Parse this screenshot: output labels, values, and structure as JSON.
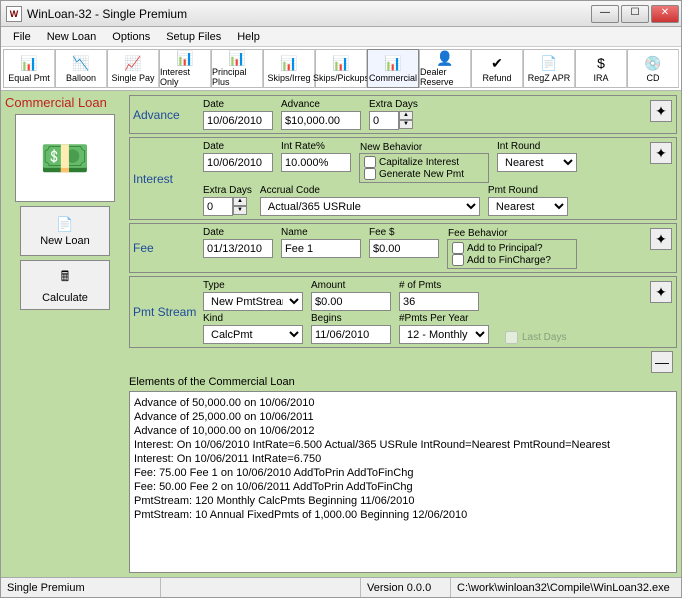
{
  "window": {
    "title": "WinLoan-32 - Single Premium",
    "icon": "W"
  },
  "menu": [
    "File",
    "New Loan",
    "Options",
    "Setup Files",
    "Help"
  ],
  "toolbar": [
    {
      "label": "Equal Pmt",
      "icon": "📊",
      "active": false
    },
    {
      "label": "Balloon",
      "icon": "📉",
      "active": false
    },
    {
      "label": "Single Pay",
      "icon": "📈",
      "active": false
    },
    {
      "label": "Interest Only",
      "icon": "📊",
      "active": false
    },
    {
      "label": "Principal Plus",
      "icon": "📊",
      "active": false
    },
    {
      "label": "Skips/Irreg",
      "icon": "📊",
      "active": false
    },
    {
      "label": "Skips/Pickups",
      "icon": "📊",
      "active": false
    },
    {
      "label": "Commercial",
      "icon": "📊",
      "active": true
    },
    {
      "label": "Dealer Reserve",
      "icon": "👤",
      "active": false
    },
    {
      "label": "Refund",
      "icon": "✔",
      "active": false
    },
    {
      "label": "RegZ APR",
      "icon": "📄",
      "active": false
    },
    {
      "label": "IRA",
      "icon": "$",
      "active": false
    },
    {
      "label": "CD",
      "icon": "💿",
      "active": false
    }
  ],
  "loan_title": "Commercial Loan",
  "left_buttons": {
    "new_loan": "New Loan",
    "calculate": "Calculate"
  },
  "advance": {
    "title": "Advance",
    "date_label": "Date",
    "date": "10/06/2010",
    "advance_label": "Advance",
    "advance": "$10,000.00",
    "extra_days_label": "Extra Days",
    "extra_days": "0"
  },
  "interest": {
    "title": "Interest",
    "date_label": "Date",
    "date": "10/06/2010",
    "rate_label": "Int Rate%",
    "rate": "10.000%",
    "new_behavior_label": "New Behavior",
    "cap_interest": "Capitalize Interest",
    "gen_new_pmt": "Generate New Pmt",
    "int_round_label": "Int Round",
    "int_round": "Nearest",
    "extra_days_label": "Extra Days",
    "extra_days": "0",
    "accrual_label": "Accrual Code",
    "accrual": "Actual/365 USRule",
    "pmt_round_label": "Pmt Round",
    "pmt_round": "Nearest"
  },
  "fee": {
    "title": "Fee",
    "date_label": "Date",
    "date": "01/13/2010",
    "name_label": "Name",
    "name": "Fee 1",
    "amount_label": "Fee $",
    "amount": "$0.00",
    "behavior_label": "Fee Behavior",
    "add_principal": "Add to Principal?",
    "add_fincharge": "Add to FinCharge?"
  },
  "pmt_stream": {
    "title": "Pmt Stream",
    "type_label": "Type",
    "type": "New PmtStream",
    "amount_label": "Amount",
    "amount": "$0.00",
    "num_pmts_label": "# of Pmts",
    "num_pmts": "36",
    "kind_label": "Kind",
    "kind": "CalcPmt",
    "begins_label": "Begins",
    "begins": "11/06/2010",
    "per_year_label": "#Pmts Per Year",
    "per_year": "12 - Monthly",
    "last_days": "Last Days"
  },
  "elements_title": "Elements of the Commercial Loan",
  "elements": [
    "Advance of 50,000.00 on 10/06/2010",
    "Advance of 25,000.00 on 10/06/2011",
    "Advance of 10,000.00 on 10/06/2012",
    "Interest: On 10/06/2010 IntRate=6.500 Actual/365 USRule IntRound=Nearest PmtRound=Nearest",
    "Interest: On 10/06/2011 IntRate=6.750",
    "Fee: 75.00 Fee 1 on 10/06/2010 AddToPrin AddToFinChg",
    "Fee: 50.00 Fee 2 on 10/06/2011 AddToPrin AddToFinChg",
    "PmtStream: 120 Monthly CalcPmts Beginning 11/06/2010",
    "PmtStream: 10 Annual FixedPmts of 1,000.00 Beginning 12/06/2010"
  ],
  "status": {
    "mode": "Single Premium",
    "version": "Version 0.0.0",
    "path": "C:\\work\\winloan32\\Compile\\WinLoan32.exe"
  }
}
